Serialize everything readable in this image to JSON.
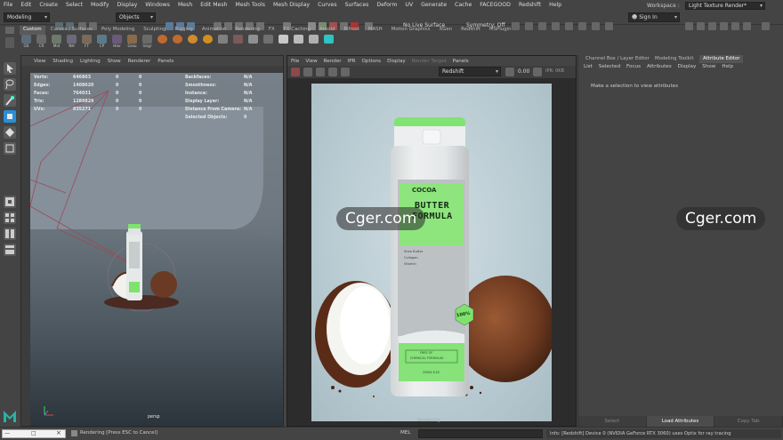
{
  "menubar": [
    "File",
    "Edit",
    "Create",
    "Select",
    "Modify",
    "Display",
    "Windows",
    "Mesh",
    "Edit Mesh",
    "Mesh Tools",
    "Mesh Display",
    "Curves",
    "Surfaces",
    "Deform",
    "UV",
    "Generate",
    "Cache",
    "FACEGOOD",
    "Redshift",
    "Help"
  ],
  "statusline": {
    "mode": "Modeling",
    "objects": "Objects",
    "live_surface": "No Live Surface",
    "symmetry": "Symmetry: Off",
    "signin": "Sign In",
    "workspace_label": "Workspace :",
    "workspace": "Light Texture Render*"
  },
  "shelf_tabs": [
    "Custom",
    "Curves / Surfaces",
    "Poly Modeling",
    "Sculpting",
    "Rigging",
    "Animation",
    "Rendering",
    "FX",
    "FX Caching",
    "Arnold",
    "Bifrost",
    "MASH",
    "Motion Graphics",
    "XGen",
    "Redshift",
    "MSPlugin"
  ],
  "shelf_buttons": [
    "OS",
    "CR",
    "Mid",
    "NH",
    "FT",
    "CP",
    "Hier",
    "Grou",
    "Ungr",
    "",
    "",
    "",
    "",
    "",
    "",
    "",
    "",
    "",
    "",
    "",
    ""
  ],
  "left_viewport": {
    "menu": [
      "View",
      "Shading",
      "Lighting",
      "Show",
      "Renderer",
      "Panels"
    ],
    "hud_left": [
      {
        "k": "Verts:",
        "a": "646863",
        "b": "0",
        "c": "0"
      },
      {
        "k": "Edges:",
        "a": "1408620",
        "b": "0",
        "c": "0"
      },
      {
        "k": "Faces:",
        "a": "764031",
        "b": "0",
        "c": "0"
      },
      {
        "k": "Tris:",
        "a": "1289829",
        "b": "0",
        "c": "0"
      },
      {
        "k": "UVs:",
        "a": "835271",
        "b": "0",
        "c": "0"
      }
    ],
    "hud_right": [
      {
        "k": "Backfaces:",
        "v": "N/A"
      },
      {
        "k": "Smoothness:",
        "v": "N/A"
      },
      {
        "k": "Instance:",
        "v": "N/A"
      },
      {
        "k": "Display Layer:",
        "v": "N/A"
      },
      {
        "k": "Distance From Camera:",
        "v": "N/A"
      },
      {
        "k": "Selected Objects:",
        "v": "0"
      }
    ],
    "camera": "persp"
  },
  "render_view": {
    "menu": [
      "File",
      "View",
      "Render",
      "IPR",
      "Options",
      "Display",
      "Render Target",
      "Panels"
    ],
    "renderer": "Redshift",
    "value": "0.00",
    "ipr_status": "IPR: 0KB",
    "footer": "Rendering",
    "bottle": {
      "brand": "COCOA",
      "title1": "BUTTER",
      "title2": "FORMULA",
      "line1": "Shea Butter",
      "line2": "Collagen",
      "line3": "Vitamin",
      "badge": "100%",
      "box_line1": "FREE OF",
      "box_line2": "CHEMICAL FORMULAS",
      "volume": "250ML 8.5Z"
    }
  },
  "attribute_editor": {
    "tabs": [
      "Channel Box / Layer Editor",
      "Modeling Toolkit",
      "Attribute Editor"
    ],
    "menu": [
      "List",
      "Selected",
      "Focus",
      "Attributes",
      "Display",
      "Show",
      "Help"
    ],
    "message": "Make a selection to view attributes",
    "buttons": [
      "Select",
      "Load Attributes",
      "Copy Tab"
    ]
  },
  "bottom": {
    "rendering": "Rendering [Press ESC to Cancel]",
    "cmd_label": "MEL",
    "info": "Info: [Redshift] Device 0 (NVIDIA GeForce RTX 3060) uses Optix for ray tracing"
  },
  "watermark": "Cger.com",
  "colors": {
    "accent_green": "#7ee36c",
    "maya_teal": "#28b2a6",
    "panel_bg": "#444444"
  }
}
